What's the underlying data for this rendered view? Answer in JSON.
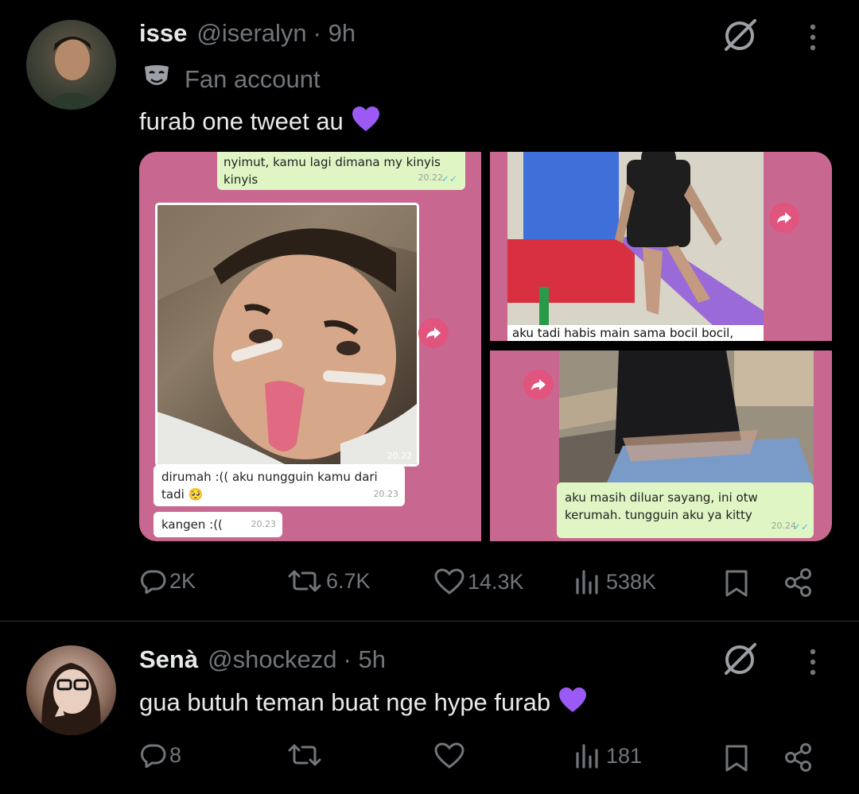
{
  "tweet1": {
    "display_name": "isse",
    "handle": "@iseralyn",
    "time": "· 9h",
    "label_text": "Fan account",
    "text": "furab one tweet au",
    "media": {
      "top_bubble": "nyimut, kamu lagi dimana my kinyis kinyis",
      "top_bubble_time": "20.22",
      "photo_time": "20.22",
      "reply1": "dirumah :(( aku nungguin kamu dari tadi",
      "reply1_time": "20.23",
      "reply2": "kangen :((",
      "reply2_time": "20.23",
      "top_right_caption": "aku tadi habis main sama bocil bocil,",
      "bottom_right_caption": "aku masih diluar sayang, ini otw kerumah. tungguin aku ya kitty",
      "bottom_right_time": "20.24"
    },
    "metrics": {
      "replies": "2K",
      "reposts": "6.7K",
      "likes": "14.3K",
      "views": "538K"
    }
  },
  "tweet2": {
    "display_name": "Senà",
    "handle": "@shockezd",
    "time": "· 5h",
    "text": "gua butuh teman buat nge hype furab",
    "metrics": {
      "replies": "8",
      "reposts": "",
      "likes": "",
      "views": "181"
    }
  },
  "colors": {
    "accent_purple": "#9b59f5",
    "muted": "#71767b",
    "chat_pink": "#c86890",
    "bubble_green": "#dff5c4"
  }
}
